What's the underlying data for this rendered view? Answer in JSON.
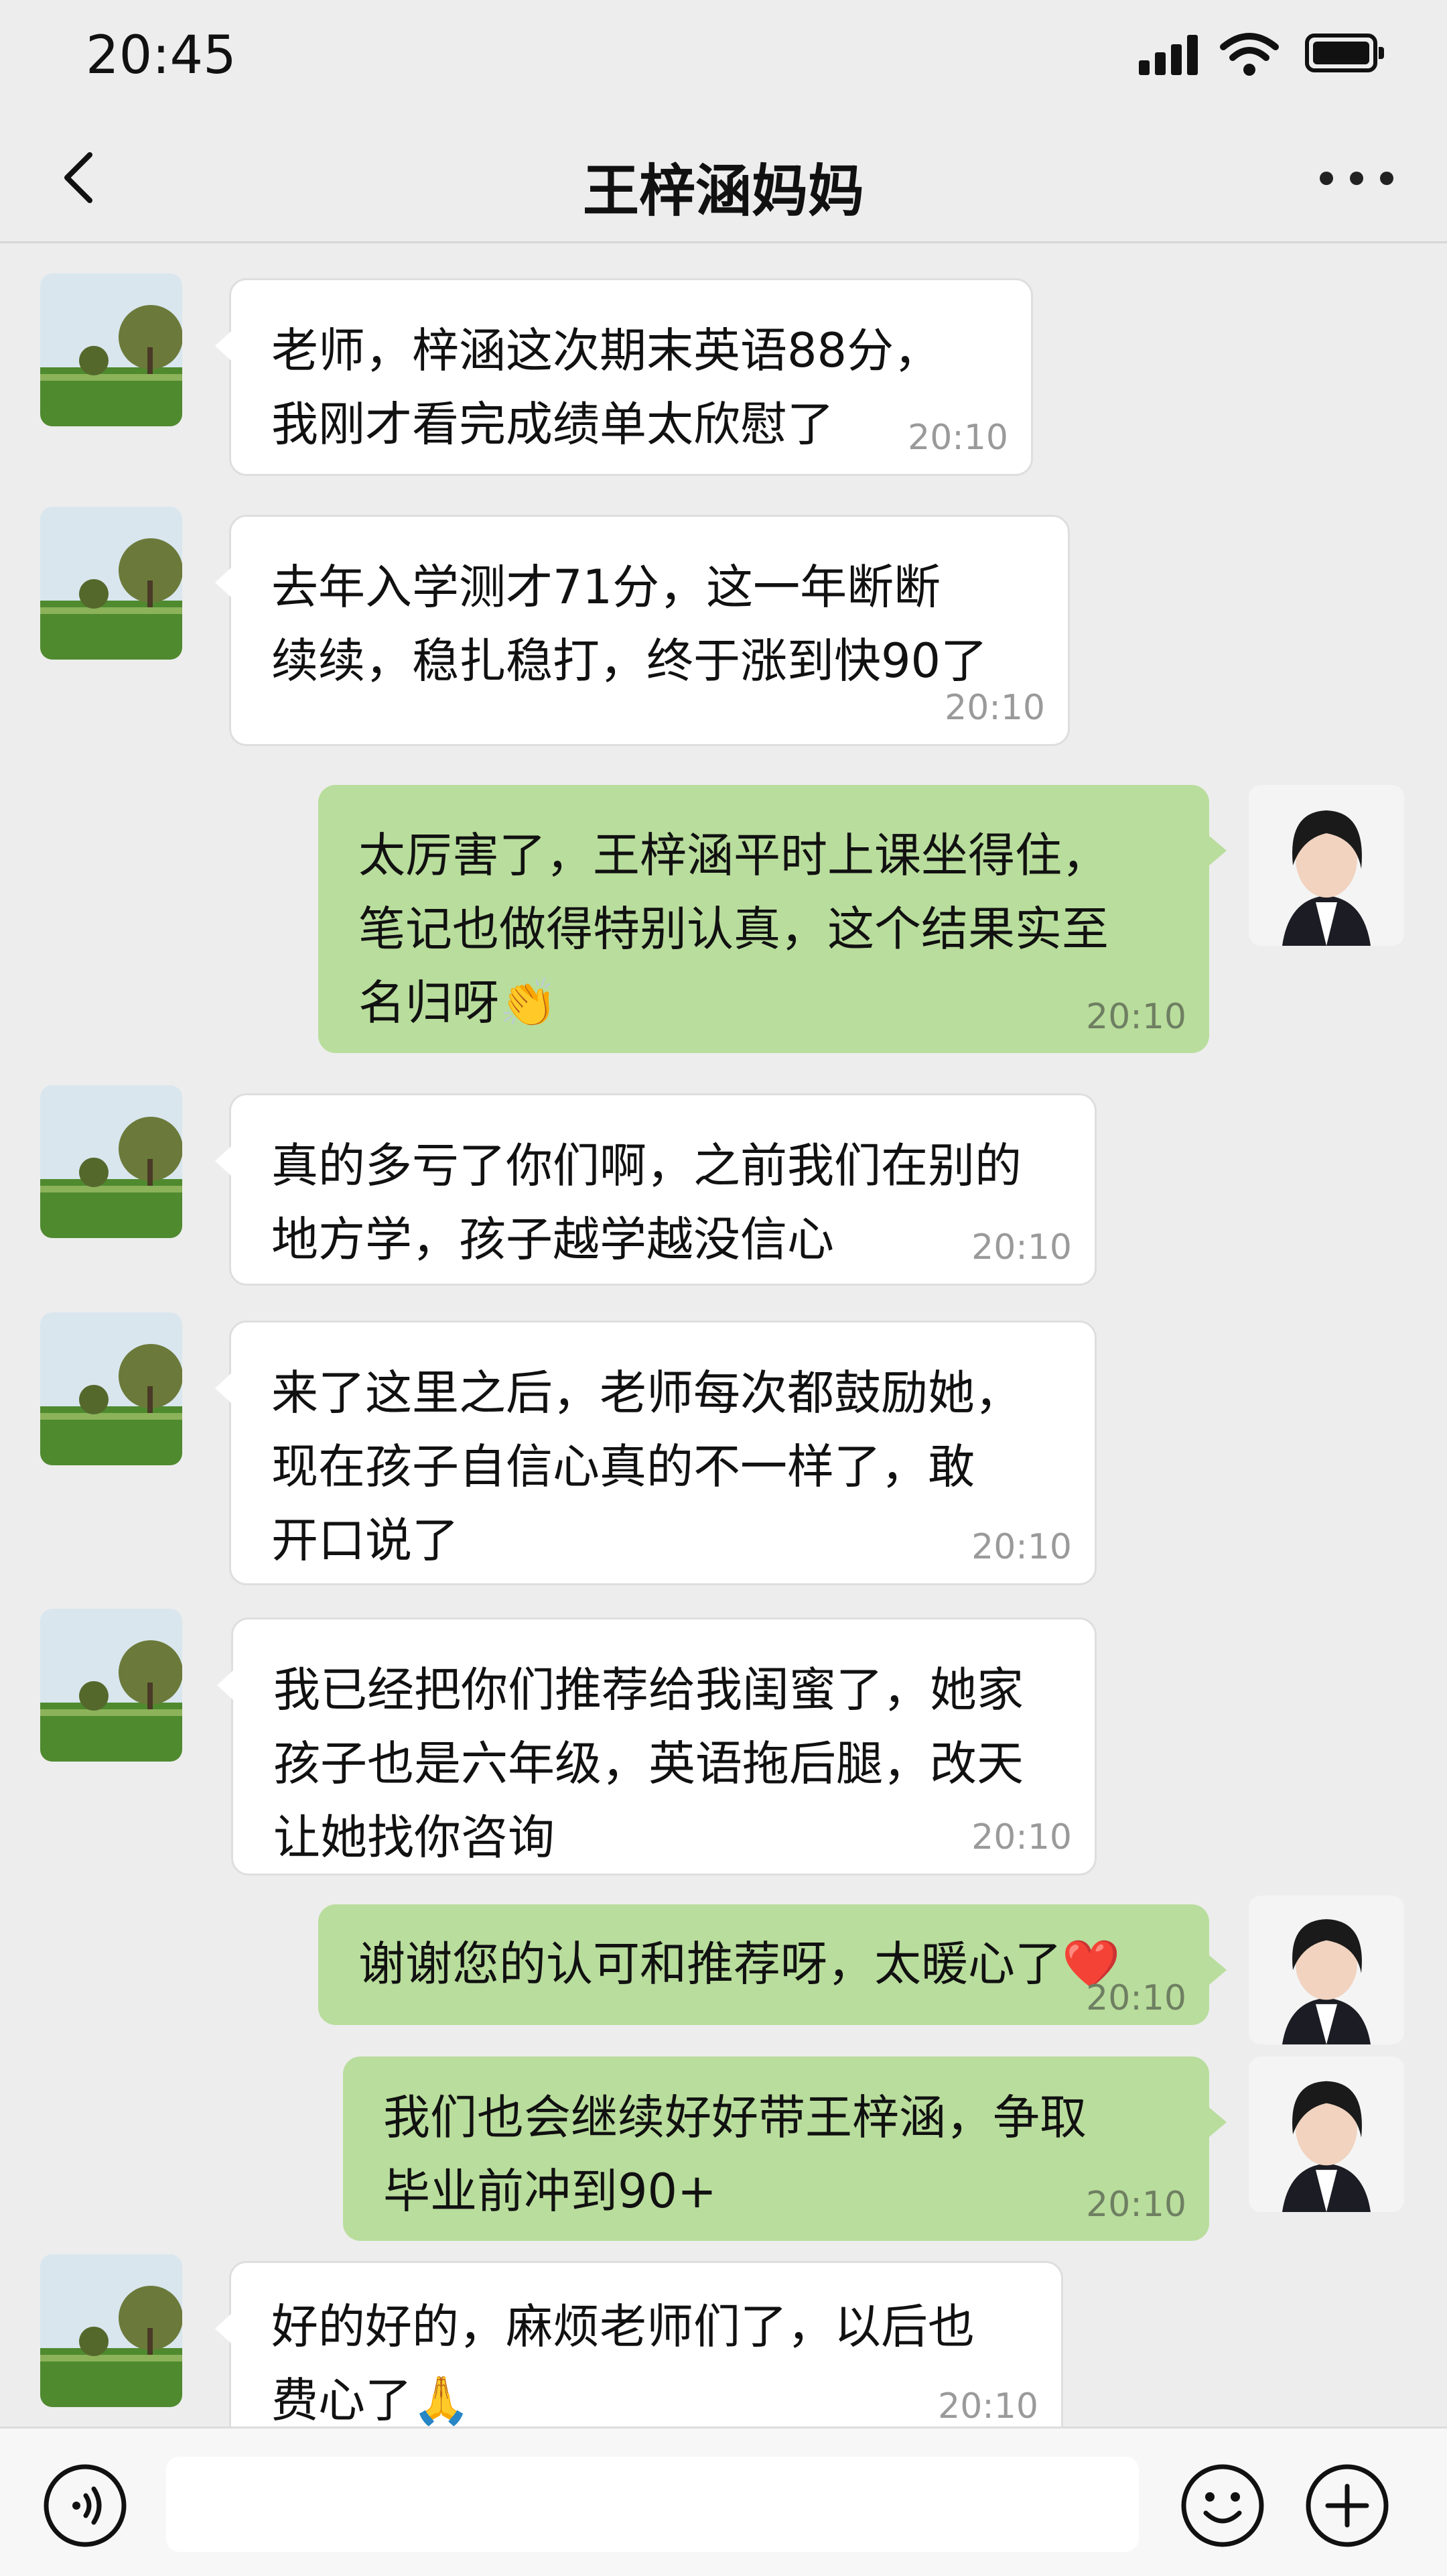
{
  "status_bar": {
    "time": "20:45"
  },
  "nav": {
    "title": "王梓涵妈妈"
  },
  "messages": [
    {
      "side": "in",
      "text": "老师，梓涵这次期末英语88分，\n我刚才看完成绩单太欣慰了",
      "time": "20:10"
    },
    {
      "side": "in",
      "text": "去年入学测才71分，这一年断断\n续续，稳扎稳打，终于涨到快90了",
      "time": "20:10"
    },
    {
      "side": "out",
      "text": "太厉害了，王梓涵平时上课坐得住，\n笔记也做得特别认真，这个结果实至\n名归呀👏",
      "time": "20:10"
    },
    {
      "side": "in",
      "text": "真的多亏了你们啊，之前我们在别的\n地方学，孩子越学越没信心",
      "time": "20:10"
    },
    {
      "side": "in",
      "text": "来了这里之后，老师每次都鼓励她，\n现在孩子自信心真的不一样了，敢\n开口说了",
      "time": "20:10"
    },
    {
      "side": "in",
      "text": "我已经把你们推荐给我闺蜜了，她家\n孩子也是六年级，英语拖后腿，改天\n让她找你咨询",
      "time": "20:10"
    },
    {
      "side": "out",
      "text": "谢谢您的认可和推荐呀，太暖心了❤️",
      "time": "20:10"
    },
    {
      "side": "out",
      "text": "我们也会继续好好带王梓涵，争取\n毕业前冲到90+",
      "time": "20:10"
    },
    {
      "side": "in",
      "text": "好的好的，麻烦老师们了，以后也\n费心了🙏",
      "time": "20:10"
    }
  ],
  "input": {
    "placeholder": ""
  },
  "icons": {
    "back": "chevron-left-icon",
    "more": "more-dots-icon",
    "voice": "voice-icon",
    "emoji": "emoji-smile-icon",
    "plus": "plus-circle-icon"
  },
  "colors": {
    "background": "#ededed",
    "incoming_bubble": "#ffffff",
    "outgoing_bubble": "#b9dd9c",
    "timestamp": "#9a9a9a"
  }
}
